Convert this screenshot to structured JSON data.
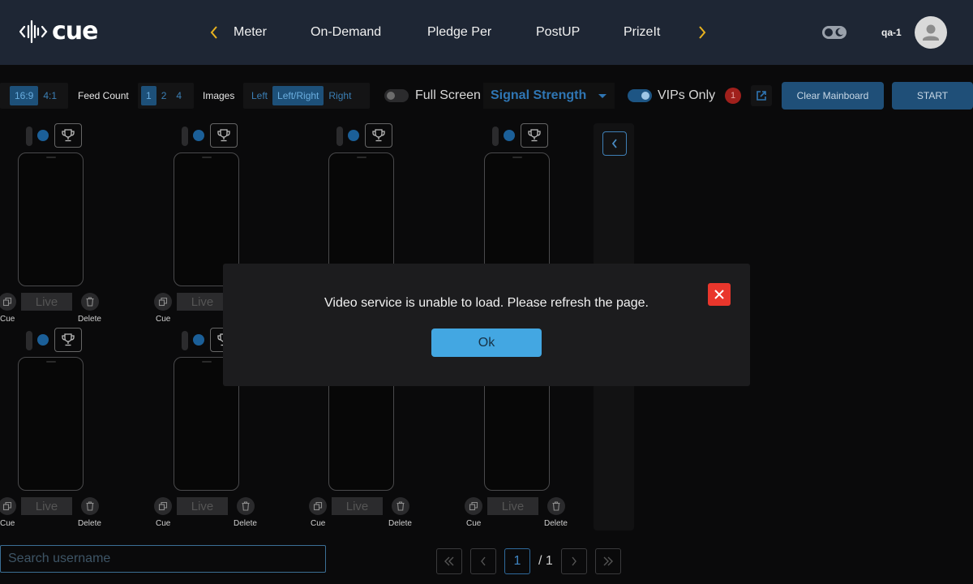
{
  "header": {
    "logo_text": "cue",
    "nav_items": [
      "Meter",
      "On-Demand",
      "Pledge Per",
      "PostUP",
      "PrizeIt"
    ],
    "user": "qa-1"
  },
  "toolbar": {
    "aspect_options": [
      "16:9",
      "4:1"
    ],
    "aspect_selected": "16:9",
    "feed_count_label": "Feed Count",
    "feed_count_options": [
      "1",
      "2",
      "4"
    ],
    "feed_count_selected": "1",
    "images_label": "Images",
    "images_options": [
      "Left",
      "Left/Right",
      "Right"
    ],
    "images_selected": "Left/Right",
    "full_screen_label": "Full Screen",
    "signal_select": "Signal Strength",
    "vips_label": "VIPs Only",
    "vips_count": "1",
    "clear_label": "Clear Mainboard",
    "start_label": "START"
  },
  "grid": {
    "live_label": "Live",
    "cue_caption": "Cue",
    "delete_caption": "Delete"
  },
  "search": {
    "placeholder": "Search username"
  },
  "pagination": {
    "current": "1",
    "total": "/ 1"
  },
  "modal": {
    "message": "Video service is unable to load. Please refresh the page.",
    "ok_label": "Ok"
  },
  "colors": {
    "header_bg": "#1e2634",
    "accent_blue": "#43a7e2",
    "nav_arrow": "#e9b31f",
    "close_red": "#e9362c"
  }
}
